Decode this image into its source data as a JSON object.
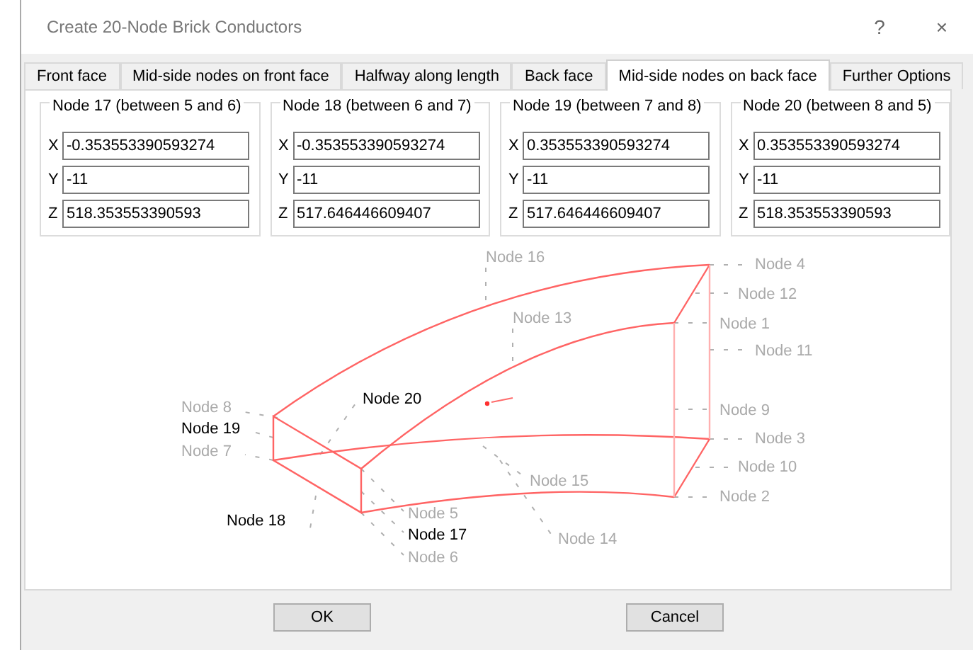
{
  "window": {
    "title": "Create 20-Node Brick Conductors",
    "help": "?",
    "close": "×"
  },
  "tabs": [
    {
      "label": "Front face",
      "selected": false
    },
    {
      "label": "Mid-side nodes on front face",
      "selected": false
    },
    {
      "label": "Halfway along length",
      "selected": false
    },
    {
      "label": "Back face",
      "selected": false
    },
    {
      "label": "Mid-side nodes on back face",
      "selected": true
    },
    {
      "label": "Further Options",
      "selected": false
    }
  ],
  "node_groups": [
    {
      "title": "Node 17 (between 5 and 6)",
      "fields": [
        {
          "label": "X",
          "value": "-0.353553390593274"
        },
        {
          "label": "Y",
          "value": "-11"
        },
        {
          "label": "Z",
          "value": "518.353553390593"
        }
      ]
    },
    {
      "title": "Node 18 (between 6 and 7)",
      "fields": [
        {
          "label": "X",
          "value": "-0.353553390593274"
        },
        {
          "label": "Y",
          "value": "-11"
        },
        {
          "label": "Z",
          "value": "517.646446609407"
        }
      ]
    },
    {
      "title": "Node 19 (between 7 and 8)",
      "fields": [
        {
          "label": "X",
          "value": "0.353553390593274"
        },
        {
          "label": "Y",
          "value": "-11"
        },
        {
          "label": "Z",
          "value": "517.646446609407"
        }
      ]
    },
    {
      "title": "Node 20 (between 8 and 5)",
      "fields": [
        {
          "label": "X",
          "value": "0.353553390593274"
        },
        {
          "label": "Y",
          "value": "-11"
        },
        {
          "label": "Z",
          "value": "518.353553390593"
        }
      ]
    }
  ],
  "diagram": {
    "labels": [
      {
        "text": "Node 16",
        "highlighted": false
      },
      {
        "text": "Node 13",
        "highlighted": false
      },
      {
        "text": "Node 4",
        "highlighted": false
      },
      {
        "text": "Node 12",
        "highlighted": false
      },
      {
        "text": "Node 1",
        "highlighted": false
      },
      {
        "text": "Node 11",
        "highlighted": false
      },
      {
        "text": "Node 20",
        "highlighted": true
      },
      {
        "text": "Node 8",
        "highlighted": false
      },
      {
        "text": "Node 19",
        "highlighted": true
      },
      {
        "text": "Node 9",
        "highlighted": false
      },
      {
        "text": "Node 7",
        "highlighted": false
      },
      {
        "text": "Node 3",
        "highlighted": false
      },
      {
        "text": "Node 10",
        "highlighted": false
      },
      {
        "text": "Node 15",
        "highlighted": false
      },
      {
        "text": "Node 2",
        "highlighted": false
      },
      {
        "text": "Node 5",
        "highlighted": false
      },
      {
        "text": "Node 18",
        "highlighted": true
      },
      {
        "text": "Node 17",
        "highlighted": true
      },
      {
        "text": "Node 14",
        "highlighted": false
      },
      {
        "text": "Node 6",
        "highlighted": false
      }
    ]
  },
  "buttons": [
    {
      "label": "OK"
    },
    {
      "label": "Cancel"
    }
  ]
}
